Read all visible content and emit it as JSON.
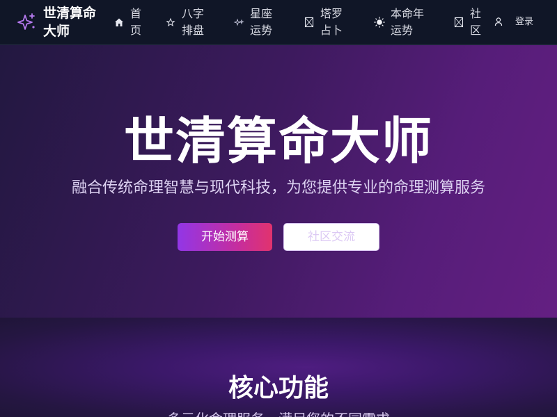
{
  "nav": {
    "brand": "世清算命大师",
    "items": [
      {
        "label": "首页",
        "icon": "home-icon"
      },
      {
        "label": "八字排盘",
        "icon": "star-outline-icon"
      },
      {
        "label": "星座运势",
        "icon": "sparkle-icon"
      },
      {
        "label": "塔罗占卜",
        "icon": "card-icon"
      },
      {
        "label": "本命年运势",
        "icon": "sun-icon"
      },
      {
        "label": "社区",
        "icon": "community-icon"
      }
    ],
    "login": "登录"
  },
  "hero": {
    "title": "世清算命大师",
    "subtitle": "融合传统命理智慧与现代科技，为您提供专业的命理测算服务",
    "primary_button": "开始测算",
    "secondary_button": "社区交流"
  },
  "features": {
    "title": "核心功能",
    "subtitle": "多元化命理服务，满足您的不同需求"
  },
  "colors": {
    "accent_purple": "#9236e6",
    "accent_pink": "#e1336e",
    "navbar_bg": "#101627"
  }
}
